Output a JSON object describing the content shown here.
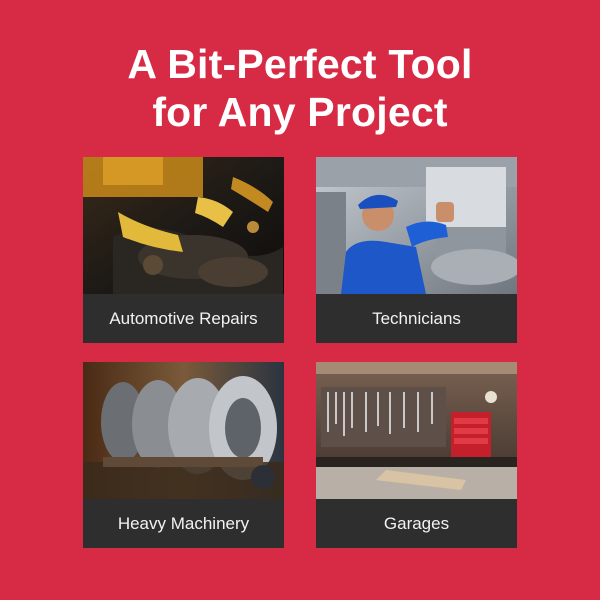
{
  "headline": {
    "line1": "A Bit-Perfect Tool",
    "line2": "for Any Project"
  },
  "cards": [
    {
      "caption": "Automotive Repairs",
      "image": "automotive-engine-photo"
    },
    {
      "caption": "Technicians",
      "image": "technician-ductwork-photo"
    },
    {
      "caption": "Heavy Machinery",
      "image": "heavy-machinery-gears-photo"
    },
    {
      "caption": "Garages",
      "image": "garage-workshop-photo"
    }
  ],
  "colors": {
    "background": "#d72a45",
    "caption_bar": "#2e2e2e",
    "text": "#ffffff"
  }
}
